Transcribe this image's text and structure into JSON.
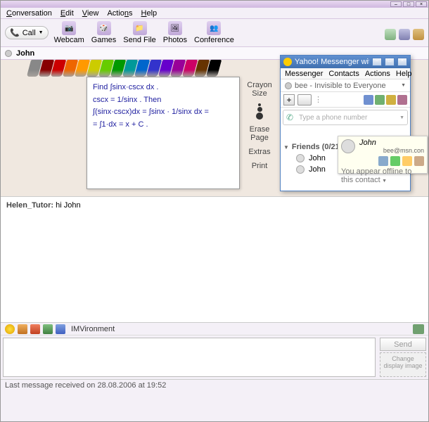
{
  "main": {
    "menubar": [
      "Conversation",
      "Edit",
      "View",
      "Actions",
      "Help"
    ],
    "toolbar": {
      "call": "Call",
      "items": [
        {
          "label": "Webcam",
          "glyph": "📷"
        },
        {
          "label": "Games",
          "glyph": "🎲"
        },
        {
          "label": "Send File",
          "glyph": "📁"
        },
        {
          "label": "Photos",
          "glyph": "🖼"
        },
        {
          "label": "Conference",
          "glyph": "👥"
        }
      ]
    },
    "contact_name": "John",
    "whiteboard": {
      "lines": [
        "Find  ∫sinx·cscx dx .",
        "cscx = 1/sinx .   Then",
        "∫(sinx·cscx)dx = ∫sinx · 1/sinx dx =",
        "= ∫1·dx = x + C ."
      ],
      "tools": {
        "crayon_size": "Crayon Size",
        "erase": "Erase Page",
        "extras": "Extras",
        "print": "Print"
      },
      "crayon_colors": [
        "#888",
        "#800",
        "#c00",
        "#e60",
        "#f90",
        "#cc0",
        "#6c0",
        "#090",
        "#099",
        "#06c",
        "#33c",
        "#60c",
        "#909",
        "#c06",
        "#630",
        "#000"
      ]
    },
    "chat": {
      "sender": "Helen_Tutor:",
      "text": " hi John"
    },
    "format": {
      "imv": "IMVironment"
    },
    "send_label": "Send",
    "change_img": "Change display image",
    "status": "Last message received on 28.08.2006 at 19:52"
  },
  "ym": {
    "title": "Yahoo! Messenger with Voice (BETA)",
    "menubar": [
      "Messenger",
      "Contacts",
      "Actions",
      "Help"
    ],
    "status_text": "bee - Invisible to Everyone",
    "phone_placeholder": "Type a phone number",
    "friends_label": "Friends (0/21",
    "contacts": [
      {
        "name": "John"
      },
      {
        "name": "John"
      }
    ]
  },
  "tooltip": {
    "name": "John",
    "email": "bee@msn.con",
    "offline": "You appear offline to this contact",
    "icon_colors": [
      "#8ac",
      "#6c6",
      "#fc6",
      "#ca8"
    ]
  }
}
